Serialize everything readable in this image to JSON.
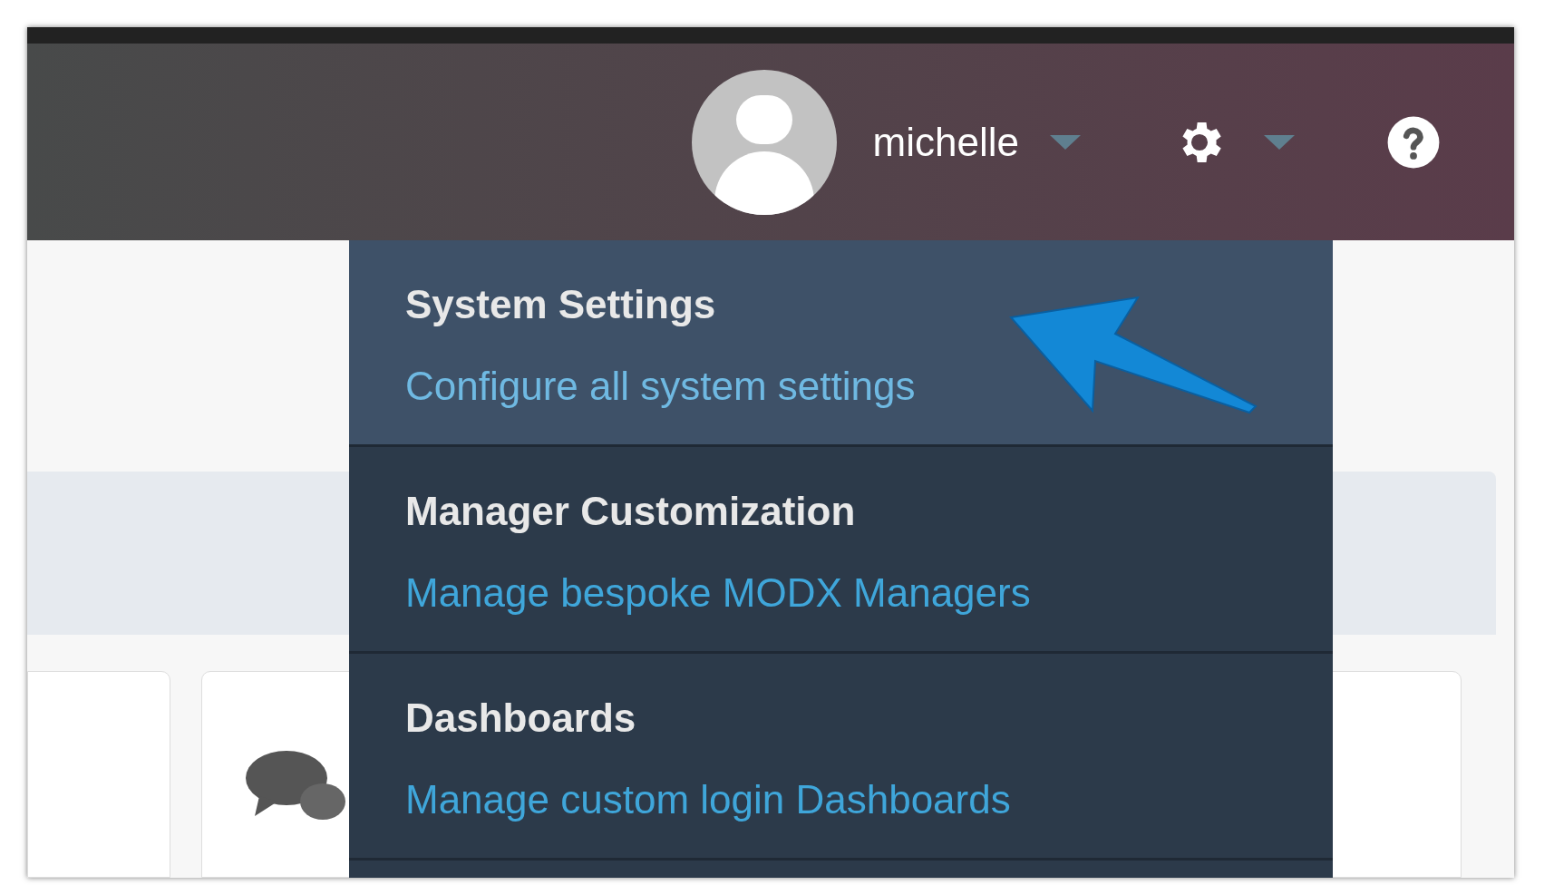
{
  "user_menu": {
    "username": "michelle"
  },
  "settings_menu": {
    "items": [
      {
        "title": "System Settings",
        "description": "Configure all system settings",
        "selected": true
      },
      {
        "title": "Manager Customization",
        "description": "Manage bespoke MODX Managers",
        "selected": false
      },
      {
        "title": "Dashboards",
        "description": "Manage custom login Dashboards",
        "selected": false
      }
    ]
  }
}
